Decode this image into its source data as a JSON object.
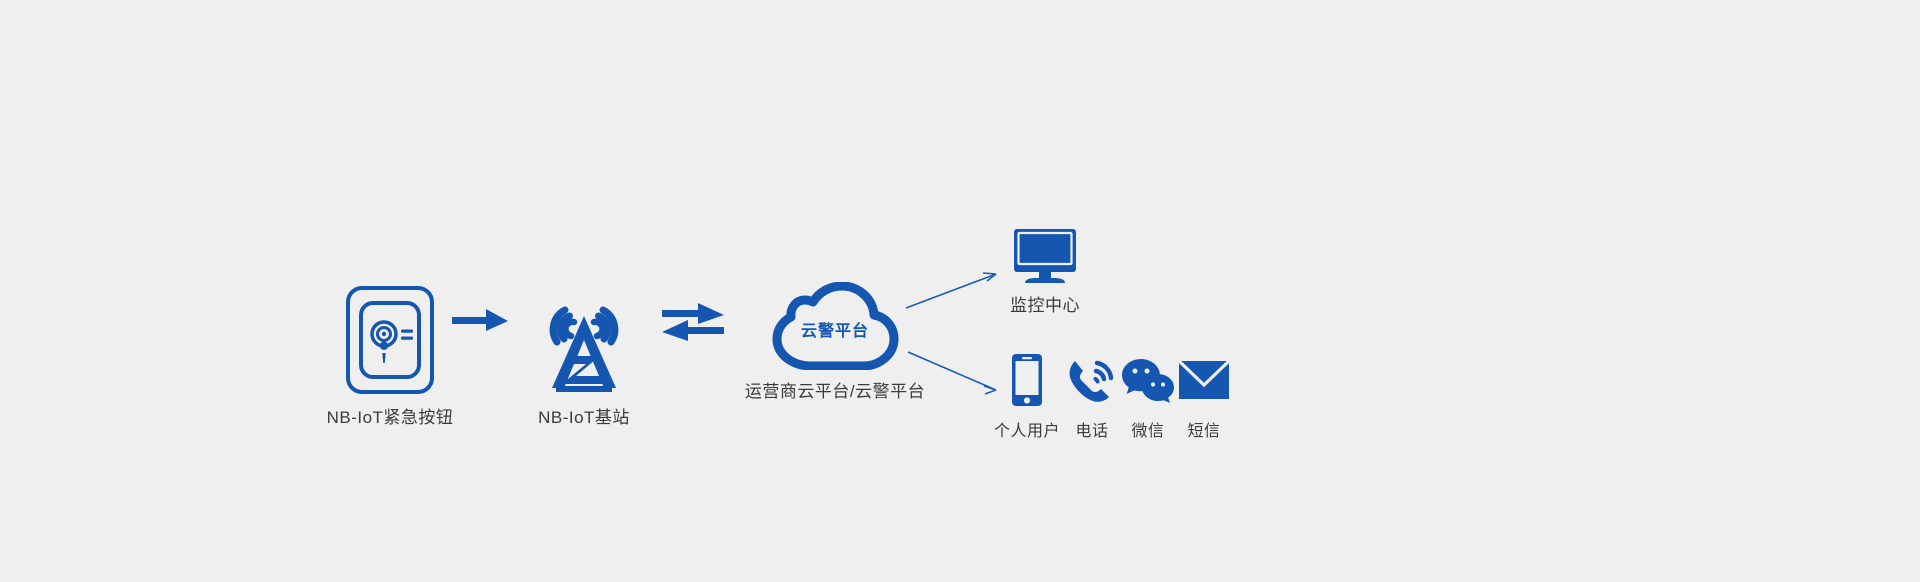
{
  "page": {
    "background_color": "#efefef",
    "accent_color": "#1557b0",
    "label_color": "#3b3b3b"
  },
  "diagram": {
    "type": "flow-architecture",
    "title": "NB-IoT emergency alarm flow",
    "flow_nodes": [
      {
        "id": "nb-iot-emergency-button",
        "label": "NB-IoT紧急按钮",
        "icon": "emergency-button-icon"
      },
      {
        "id": "nb-iot-base-station",
        "label": "NB-IoT基站",
        "icon": "cell-tower-icon"
      },
      {
        "id": "cloud-platform",
        "label": "运营商云平台/云警平台",
        "icon": "cloud-icon",
        "inner_text": "云警平台"
      }
    ],
    "connectors": [
      {
        "id": "button-to-tower",
        "style": "solid-arrow",
        "direction": "right"
      },
      {
        "id": "tower-to-cloud",
        "style": "double-arrow",
        "direction": "bidirectional"
      },
      {
        "id": "cloud-to-monitor",
        "style": "thin-line-arrow",
        "direction": "up-right"
      },
      {
        "id": "cloud-to-endpoints",
        "style": "thin-line-arrow",
        "direction": "down-right"
      }
    ],
    "monitor_node": {
      "id": "monitoring-center",
      "label": "监控中心",
      "icon": "desktop-monitor-icon"
    },
    "endpoints": [
      {
        "id": "personal-user",
        "label": "个人用户",
        "icon": "smartphone-icon"
      },
      {
        "id": "phone-call",
        "label": "电话",
        "icon": "telephone-ringing-icon"
      },
      {
        "id": "wechat",
        "label": "微信",
        "icon": "wechat-bubbles-icon"
      },
      {
        "id": "sms",
        "label": "短信",
        "icon": "envelope-icon"
      }
    ]
  }
}
